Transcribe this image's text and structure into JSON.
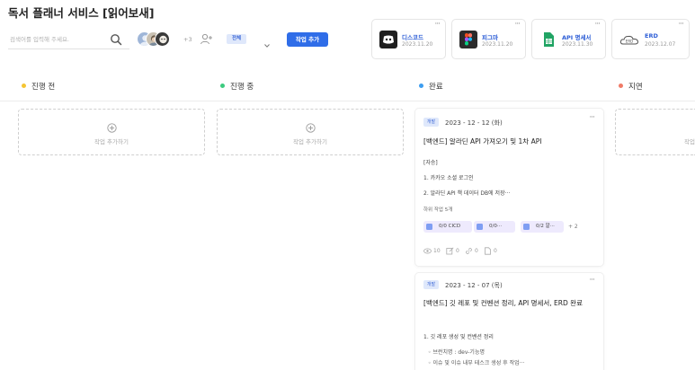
{
  "page": {
    "title": "독서 플래너 서비스 [읽어보새]"
  },
  "toolbar": {
    "search_placeholder": "검색어를 입력해 주세요.",
    "more_members": "+3",
    "filter_value": "전체",
    "add_task_label": "작업 추가"
  },
  "links": [
    {
      "name": "디스코드",
      "date": "2023.11.20",
      "icon": "discord-icon",
      "color": "#1f1f1f"
    },
    {
      "name": "피그마",
      "date": "2023.11.20",
      "icon": "figma-icon",
      "color": "#2b2b2b"
    },
    {
      "name": "API 명세서",
      "date": "2023.11.30",
      "icon": "sheets-icon",
      "color": "#21a464"
    },
    {
      "name": "ERD",
      "date": "2023.12.07",
      "icon": "erd-cloud-icon",
      "color": "#555555"
    }
  ],
  "columns": [
    {
      "title": "진행 전",
      "color": "#f5c533",
      "add_label": "작업 추가하기"
    },
    {
      "title": "진행 중",
      "color": "#3ccb7f",
      "add_label": "작업 추가하기"
    },
    {
      "title": "완료",
      "color": "#3d9df0"
    },
    {
      "title": "지연",
      "color": "#f07b67",
      "add_label": "작업 추가하기"
    }
  ],
  "tasks": [
    {
      "tag": "개발",
      "date": "2023 - 12 - 12 (화)",
      "title": "[백엔드] 알라딘 API 가져오기 및 1차 API",
      "lines": [
        "[자승]",
        "1. 카카오 소셜 로그인",
        "2. 알라딘 API 책 데이터 DB에 저장···"
      ],
      "subtask_label": "하위 작업 5개",
      "subtasks": [
        "0/0 CICD",
        "0/0···",
        "0/2 알···"
      ],
      "subtask_more": "+ 2",
      "stats": {
        "views": "10",
        "edits": "0",
        "links": "0",
        "files": "0"
      }
    },
    {
      "tag": "개발",
      "date": "2023 - 12 - 07 (목)",
      "title": "[백엔드] 깃 레포 및 컨벤션 정리, API 명세서, ERD 완료",
      "lines": [
        "1. 깃 레포 생성 및 컨벤션 정리"
      ],
      "sublines": [
        "브런치명 : dev-기능명",
        "이슈 및 이슈 내부 테스크 생성 후 작업···"
      ]
    }
  ],
  "colors": {
    "accent": "#2f6de8",
    "tag_bg": "#dfe8fb",
    "chip_bg": "#eeeafd"
  }
}
